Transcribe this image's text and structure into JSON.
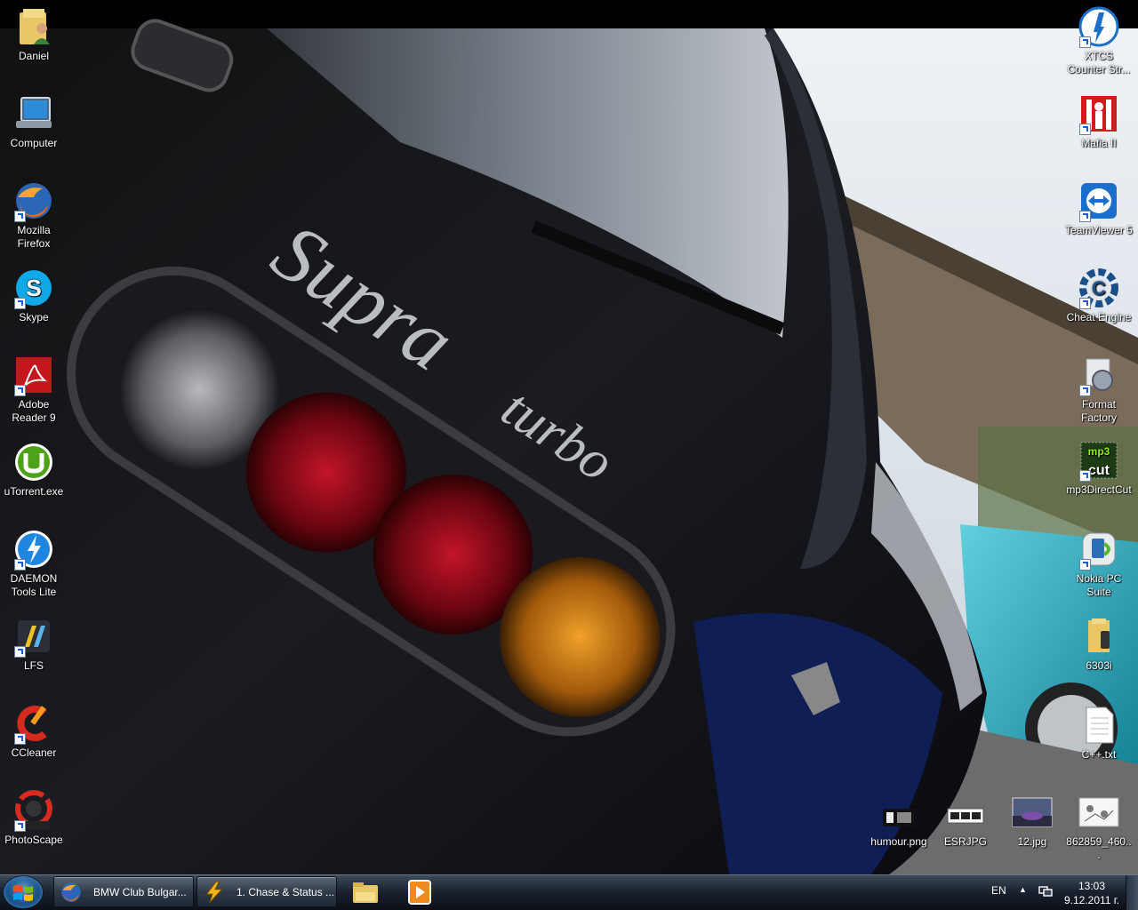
{
  "desktop": {
    "left_icons": [
      {
        "label": "Daniel",
        "icon": "user-folder-icon"
      },
      {
        "label": "Computer",
        "icon": "computer-icon"
      },
      {
        "label": "Mozilla Firefox",
        "icon": "firefox-icon"
      },
      {
        "label": "Skype",
        "icon": "skype-icon"
      },
      {
        "label": "Adobe Reader 9",
        "icon": "adobe-reader-icon"
      },
      {
        "label": "uTorrent.exe",
        "icon": "utorrent-icon"
      },
      {
        "label": "DAEMON Tools Lite",
        "icon": "daemon-tools-icon"
      },
      {
        "label": "LFS",
        "icon": "lfs-icon"
      },
      {
        "label": "CCleaner",
        "icon": "ccleaner-icon"
      },
      {
        "label": "PhotoScape",
        "icon": "photoscape-icon"
      }
    ],
    "right_icons": [
      {
        "label": "XTCS Counter Str...",
        "icon": "counter-strike-icon"
      },
      {
        "label": "Mafia II",
        "icon": "mafia-icon"
      },
      {
        "label": "TeamViewer 5",
        "icon": "teamviewer-icon"
      },
      {
        "label": "Cheat Engine",
        "icon": "cheat-engine-icon"
      },
      {
        "label": "Format Factory",
        "icon": "format-factory-icon"
      },
      {
        "label": "mp3DirectCut",
        "icon": "mp3directcut-icon"
      },
      {
        "label": "Nokia PC Suite",
        "icon": "nokia-pc-suite-icon"
      },
      {
        "label": "6303i",
        "icon": "folder-icon"
      },
      {
        "label": "C++.txt",
        "icon": "text-file-icon"
      }
    ],
    "bottom_icons": [
      {
        "label": "humour.png",
        "icon": "image-file-icon"
      },
      {
        "label": "ESRJPG",
        "icon": "image-file-icon"
      },
      {
        "label": "12.jpg",
        "icon": "image-file-icon"
      },
      {
        "label": "862859_460...",
        "icon": "image-file-icon"
      }
    ],
    "wallpaper_text": {
      "model": "Supra",
      "badge": "turbo"
    }
  },
  "taskbar": {
    "tasks": [
      {
        "label": "BMW Club Bulgar...",
        "icon": "firefox-icon"
      },
      {
        "label": "1. Chase & Status ...",
        "icon": "winamp-icon"
      }
    ],
    "pinned": [
      {
        "name": "windows-explorer-icon"
      },
      {
        "name": "media-player-icon"
      }
    ],
    "tray": {
      "language": "EN",
      "time": "13:03",
      "date": "9.12.2011 г."
    }
  },
  "colors": {
    "taskbar": "#1b2330",
    "accent": "#1d5fd0"
  }
}
